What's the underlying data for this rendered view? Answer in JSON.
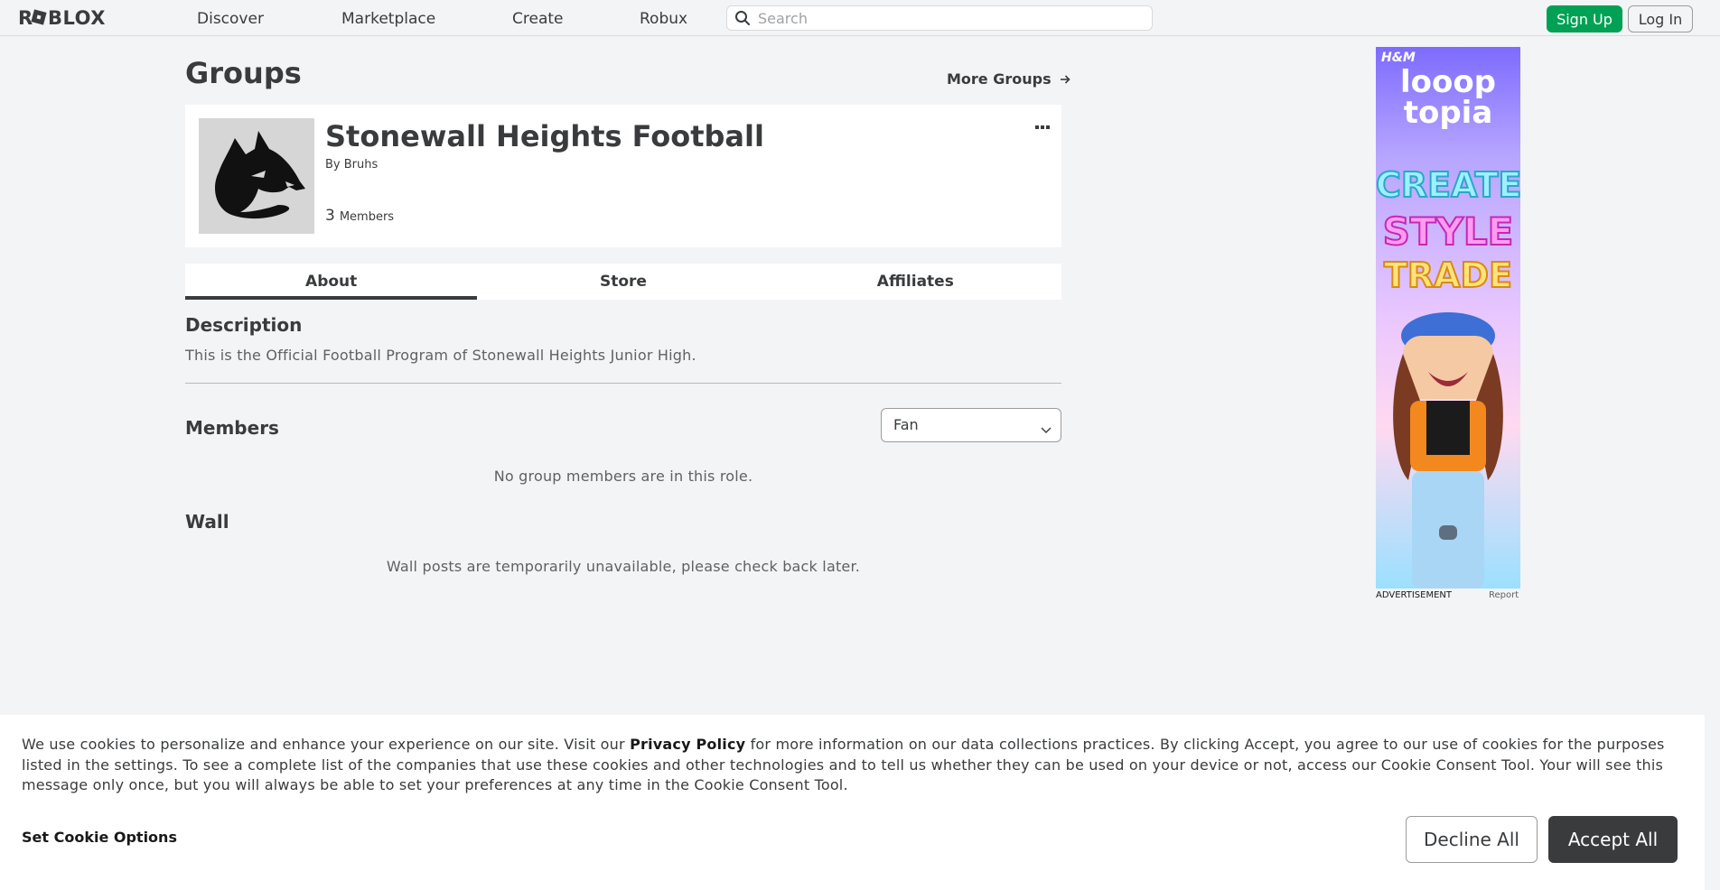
{
  "header": {
    "logo": "R■BLOX",
    "nav": [
      "Discover",
      "Marketplace",
      "Create",
      "Robux"
    ],
    "search_placeholder": "Search",
    "signup_label": "Sign Up",
    "login_label": "Log In"
  },
  "page": {
    "title": "Groups",
    "more_groups": "More Groups"
  },
  "group": {
    "name": "Stonewall Heights Football",
    "owner_prefix": "By",
    "owner": "Bruhs",
    "member_count": "3",
    "members_label": "Members"
  },
  "tabs": [
    {
      "label": "About",
      "active": true
    },
    {
      "label": "Store",
      "active": false
    },
    {
      "label": "Affiliates",
      "active": false
    }
  ],
  "about": {
    "description_heading": "Description",
    "description": "This is the Official Football Program of Stonewall Heights Junior High.",
    "members_heading": "Members",
    "role_selected": "Fan",
    "members_empty": "No group members are in this role.",
    "wall_heading": "Wall",
    "wall_empty": "Wall posts are temporarily unavailable, please check back later."
  },
  "ad": {
    "brand": "H&M",
    "line1": "looop",
    "line2": "topia",
    "line3": "CREATE",
    "line4": "STYLE",
    "line5": "TRADE",
    "label": "ADVERTISEMENT",
    "report": "Report"
  },
  "cookie": {
    "text_before": "We use cookies to personalize and enhance your experience on our site. Visit our ",
    "privacy_link": "Privacy Policy",
    "text_after": " for more information on our data collections practices. By clicking Accept, you agree to our use of cookies for the purposes listed in the settings. To see a complete list of the companies that use these cookies and other technologies and to tell us whether they can be used on your device or not, access our Cookie Consent Tool. Your will see this message only once, but you will always be able to set your preferences at any time in the Cookie Consent Tool.",
    "set_options": "Set Cookie Options",
    "decline": "Decline All",
    "accept": "Accept All"
  },
  "colors": {
    "background": "#f2f4f5",
    "signup": "#00a155",
    "accept": "#393b3d",
    "text": "#393b3d"
  }
}
